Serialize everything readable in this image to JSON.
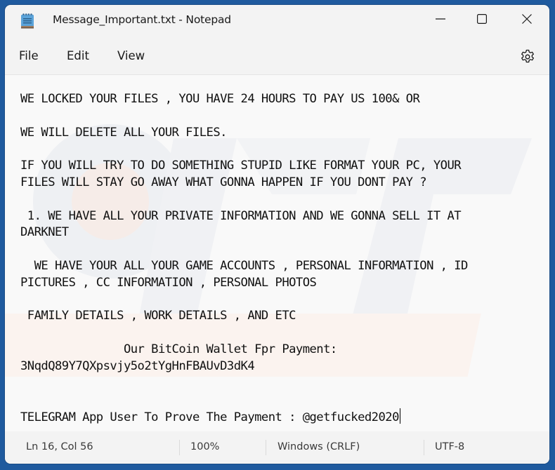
{
  "window": {
    "title": "Message_Important.txt - Notepad",
    "app_icon": "notepad-icon",
    "controls": {
      "minimize": "minimize-icon",
      "maximize": "maximize-icon",
      "close": "close-icon"
    }
  },
  "menu": {
    "items": [
      {
        "label": "File"
      },
      {
        "label": "Edit"
      },
      {
        "label": "View"
      }
    ],
    "settings_icon": "gear-icon"
  },
  "document": {
    "lines": [
      "WE LOCKED YOUR FILES , YOU HAVE 24 HOURS TO PAY US 100& OR",
      "",
      "WE WILL DELETE ALL YOUR FILES.",
      "",
      "IF YOU WILL TRY TO DO SOMETHING STUPID LIKE FORMAT YOUR PC, YOUR",
      "FILES WILL STAY GO AWAY WHAT GONNA HAPPEN IF YOU DONT PAY ?",
      "",
      " 1. WE HAVE ALL YOUR PRIVATE INFORMATION AND WE GONNA SELL IT AT",
      "DARKNET",
      "",
      "  WE HAVE YOUR ALL YOUR GAME ACCOUNTS , PERSONAL INFORMATION , ID",
      "PICTURES , CC INFORMATION , PERSONAL PHOTOS",
      "",
      " FAMILY DETAILS , WORK DETAILS , AND ETC",
      "",
      "               Our BitCoin Wallet Fpr Payment:",
      "3NqdQ89Y7QXpsvjy5o2tYgHnFBAUvD3dK4",
      "",
      "",
      "TELEGRAM App User To Prove The Payment : @getfucked2020"
    ]
  },
  "status": {
    "position": "Ln 16, Col 56",
    "zoom": "100%",
    "line_ending": "Windows (CRLF)",
    "encoding": "UTF-8"
  }
}
